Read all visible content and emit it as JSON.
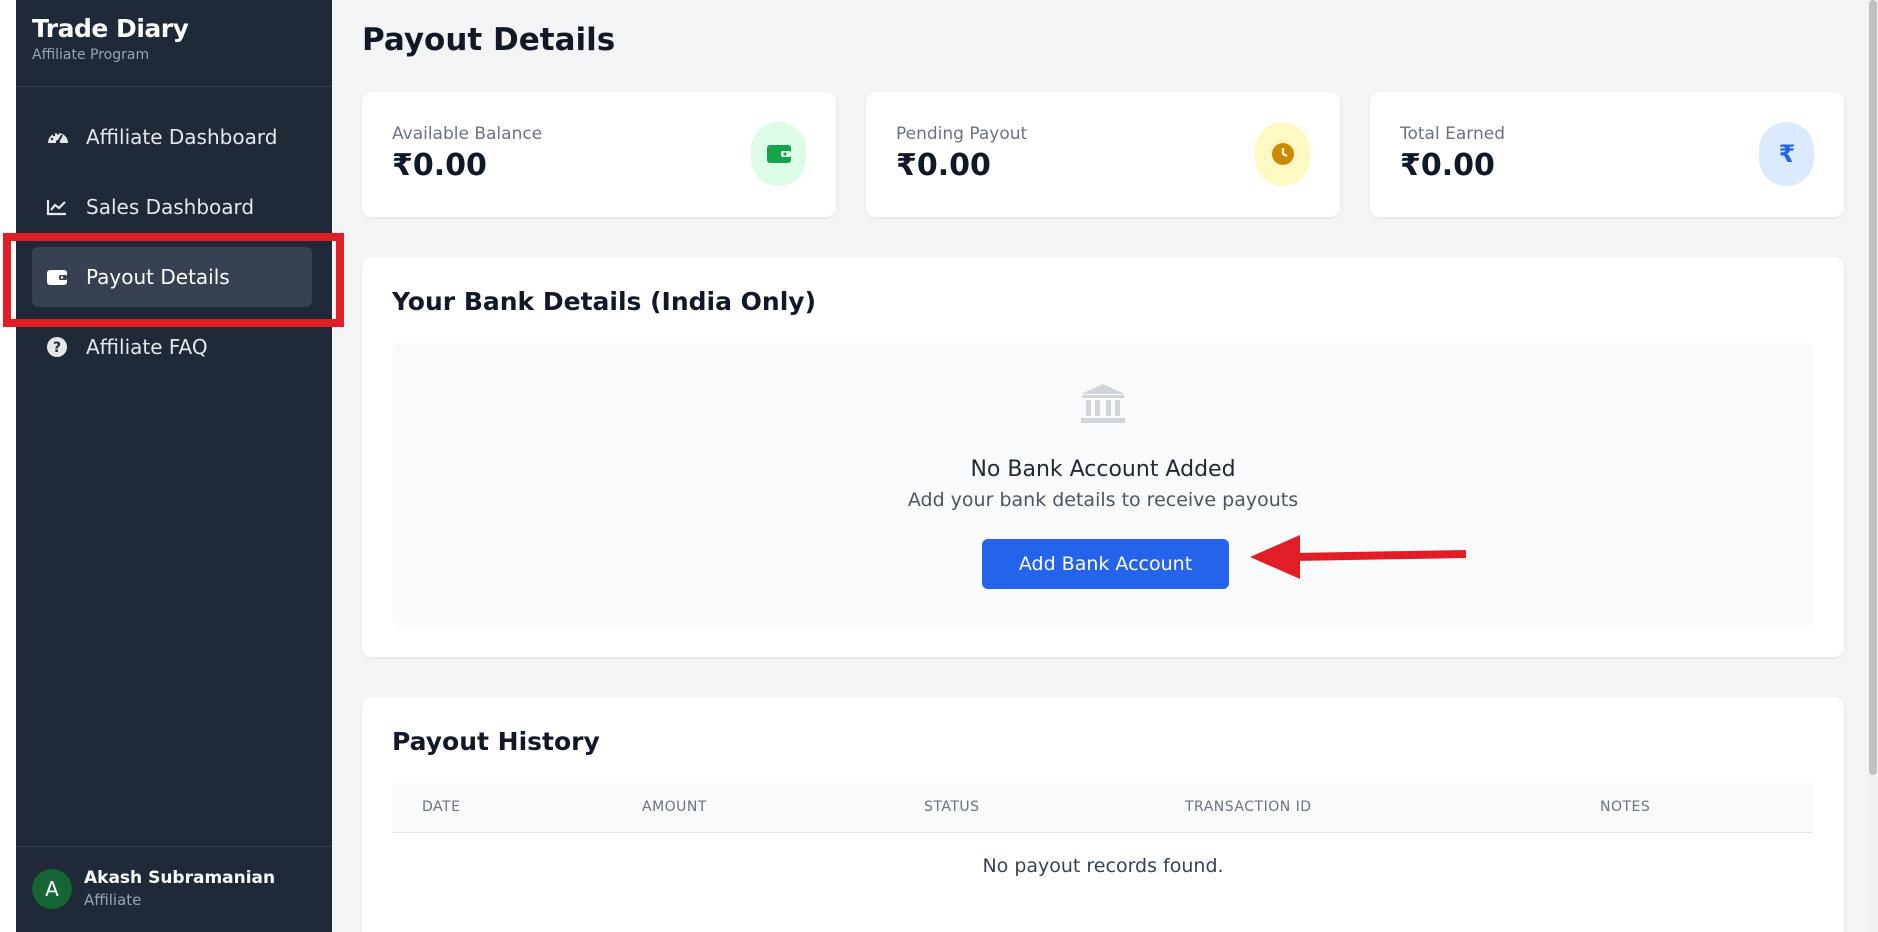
{
  "brand": {
    "title": "Trade Diary",
    "subtitle": "Affiliate Program"
  },
  "sidebar": {
    "items": [
      {
        "label": "Affiliate Dashboard",
        "icon": "gauge-icon",
        "active": false
      },
      {
        "label": "Sales Dashboard",
        "icon": "chart-line-icon",
        "active": false
      },
      {
        "label": "Payout Details",
        "icon": "wallet-icon",
        "active": true
      },
      {
        "label": "Affiliate FAQ",
        "icon": "question-circle-icon",
        "active": false
      }
    ]
  },
  "user": {
    "initial": "A",
    "name": "Akash Subramanian",
    "role": "Affiliate"
  },
  "page": {
    "title": "Payout Details"
  },
  "stats": [
    {
      "label": "Available Balance",
      "value": "₹0.00",
      "icon": "wallet-icon",
      "color": "#16a34a",
      "bg": "#dcfce7"
    },
    {
      "label": "Pending Payout",
      "value": "₹0.00",
      "icon": "clock-icon",
      "color": "#ca8a04",
      "bg": "#fef9c3"
    },
    {
      "label": "Total Earned",
      "value": "₹0.00",
      "icon": "rupee-icon",
      "color": "#2563eb",
      "bg": "#dbeafe"
    }
  ],
  "bank": {
    "title": "Your Bank Details (India Only)",
    "empty_title": "No Bank Account Added",
    "empty_subtitle": "Add your bank details to receive payouts",
    "button_label": "Add Bank Account"
  },
  "history": {
    "title": "Payout History",
    "columns": [
      "DATE",
      "AMOUNT",
      "STATUS",
      "TRANSACTION ID",
      "NOTES"
    ],
    "empty_text": "No payout records found."
  },
  "colors": {
    "sidebar_bg": "#1f2937",
    "accent": "#2563eb",
    "highlight": "#e11d26"
  }
}
